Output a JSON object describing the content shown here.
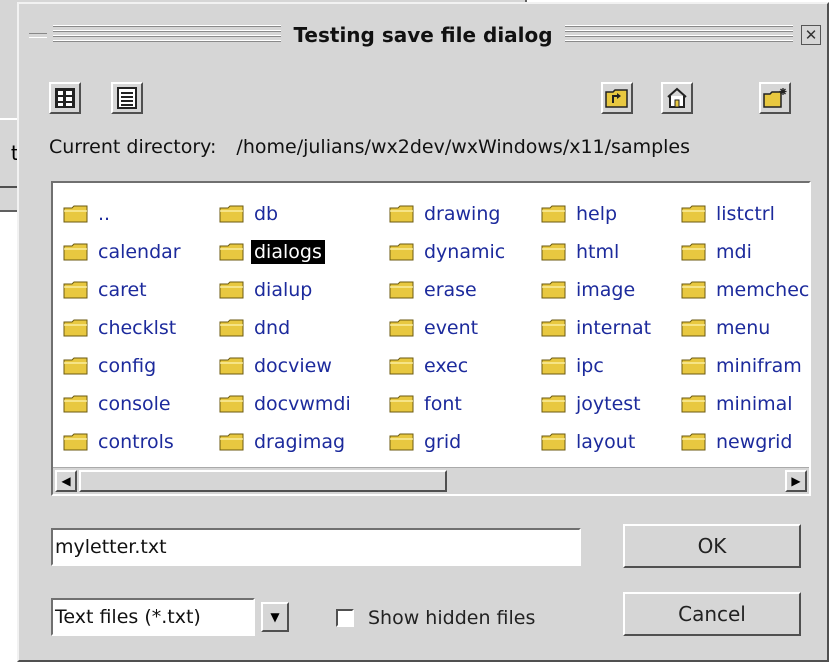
{
  "background_window": {
    "partial_button_label": "ta"
  },
  "dialog": {
    "title": "Testing save file dialog",
    "close_label": "✕"
  },
  "toolbar": {
    "icons": [
      "list-view-icon",
      "detail-view-icon",
      "parent-directory-icon",
      "home-icon",
      "new-folder-icon"
    ]
  },
  "current_directory": {
    "label": "Current directory:",
    "path": "/home/julians/wx2dev/wxWindows/x11/samples"
  },
  "file_list": {
    "columns": [
      [
        "..",
        "calendar",
        "caret",
        "checklst",
        "config",
        "console",
        "controls"
      ],
      [
        "db",
        "dialogs",
        "dialup",
        "dnd",
        "docview",
        "docvwmdi",
        "dragimag"
      ],
      [
        "drawing",
        "dynamic",
        "erase",
        "event",
        "exec",
        "font",
        "grid"
      ],
      [
        "help",
        "html",
        "image",
        "internat",
        "ipc",
        "joytest",
        "layout"
      ],
      [
        "listctrl",
        "mdi",
        "memcheck",
        "menu",
        "minifram",
        "minimal",
        "newgrid"
      ]
    ],
    "selected": "dialogs",
    "folder_color": "#e8c840"
  },
  "filename": {
    "value": "myletter.txt"
  },
  "ok_button": {
    "label": "OK"
  },
  "cancel_button": {
    "label": "Cancel"
  },
  "file_type": {
    "selected": "Text files (*.txt)"
  },
  "show_hidden": {
    "label": "Show hidden files",
    "checked": false
  }
}
